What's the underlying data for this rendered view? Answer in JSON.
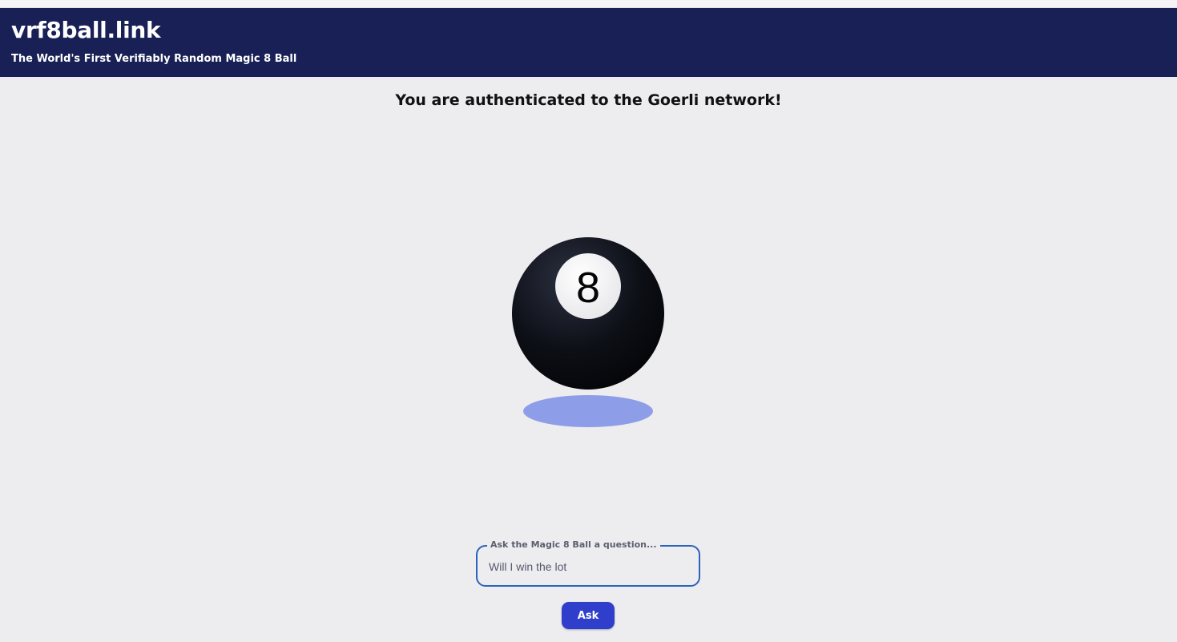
{
  "header": {
    "title": "vrf8ball.link",
    "subtitle": "The World's First Verifiably Random Magic 8 Ball"
  },
  "status": {
    "message": "You are authenticated to the Goerli network!"
  },
  "ball": {
    "number": "8",
    "icon": "magic-8-ball-icon"
  },
  "question": {
    "legend": "Ask the Magic 8 Ball a question...",
    "value": "Will I win the lot"
  },
  "actions": {
    "ask_label": "Ask"
  },
  "colors": {
    "header_bg": "#182056",
    "page_bg": "#ededf0",
    "accent": "#2f3ecb",
    "input_border": "#2b63b8",
    "shadow": "#8e9de8"
  }
}
